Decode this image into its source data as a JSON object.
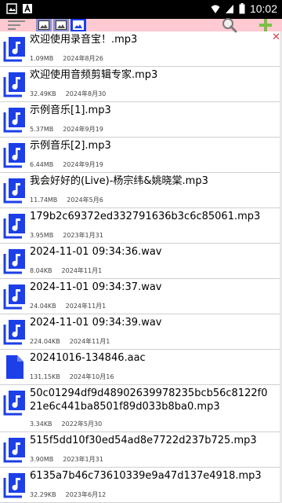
{
  "status": {
    "time": "10:02"
  },
  "colors": {
    "accent": "#1c3fe8",
    "toolbar": "#ffc9d1",
    "add": "#7ac043"
  },
  "icons": {
    "list_menu": "list-menu-icon",
    "search": "search-icon",
    "add": "plus-icon",
    "close": "close-icon",
    "audio": "audio-file-icon",
    "plain": "file-icon"
  },
  "files": [
    {
      "name": "欢迎使用录音宝！.mp3",
      "size": "1.09MB",
      "date": "2024年8月26"
    },
    {
      "name": "欢迎使用音频剪辑专家.mp3",
      "size": "32.49KB",
      "date": "2024年8月30"
    },
    {
      "name": "示例音乐[1].mp3",
      "size": "5.37MB",
      "date": "2024年9月19"
    },
    {
      "name": "示例音乐[2].mp3",
      "size": "6.44MB",
      "date": "2024年9月19"
    },
    {
      "name": "我会好好的(Live)-杨宗纬&姚晓棠.mp3",
      "size": "11.74MB",
      "date": "2024年5月6"
    },
    {
      "name": "179b2c69372ed332791636b3c6c85061.mp3",
      "size": "3.95MB",
      "date": "2023年1月31"
    },
    {
      "name": "2024-11-01 09:34:36.wav",
      "size": "8.04KB",
      "date": "2024年11月1"
    },
    {
      "name": "2024-11-01 09:34:37.wav",
      "size": "24.04KB",
      "date": "2024年11月1"
    },
    {
      "name": "2024-11-01 09:34:39.wav",
      "size": "224.04KB",
      "date": "2024年11月1"
    },
    {
      "name": "20241016-134846.aac",
      "size": "131.15KB",
      "date": "2024年10月16"
    },
    {
      "name": "50c01294df9d48902639978235bcb56c8122f021e6c441ba8501f89d033b8ba0.mp3",
      "size": "3.34KB",
      "date": "2022年5月30"
    },
    {
      "name": "515f5dd10f30ed54ad8e7722d237b725.mp3",
      "size": "3.90MB",
      "date": "2023年1月31"
    },
    {
      "name": "6135a7b46c73610339e9a47d137e4918.mp3",
      "size": "32.29KB",
      "date": "2023年6月12"
    }
  ]
}
